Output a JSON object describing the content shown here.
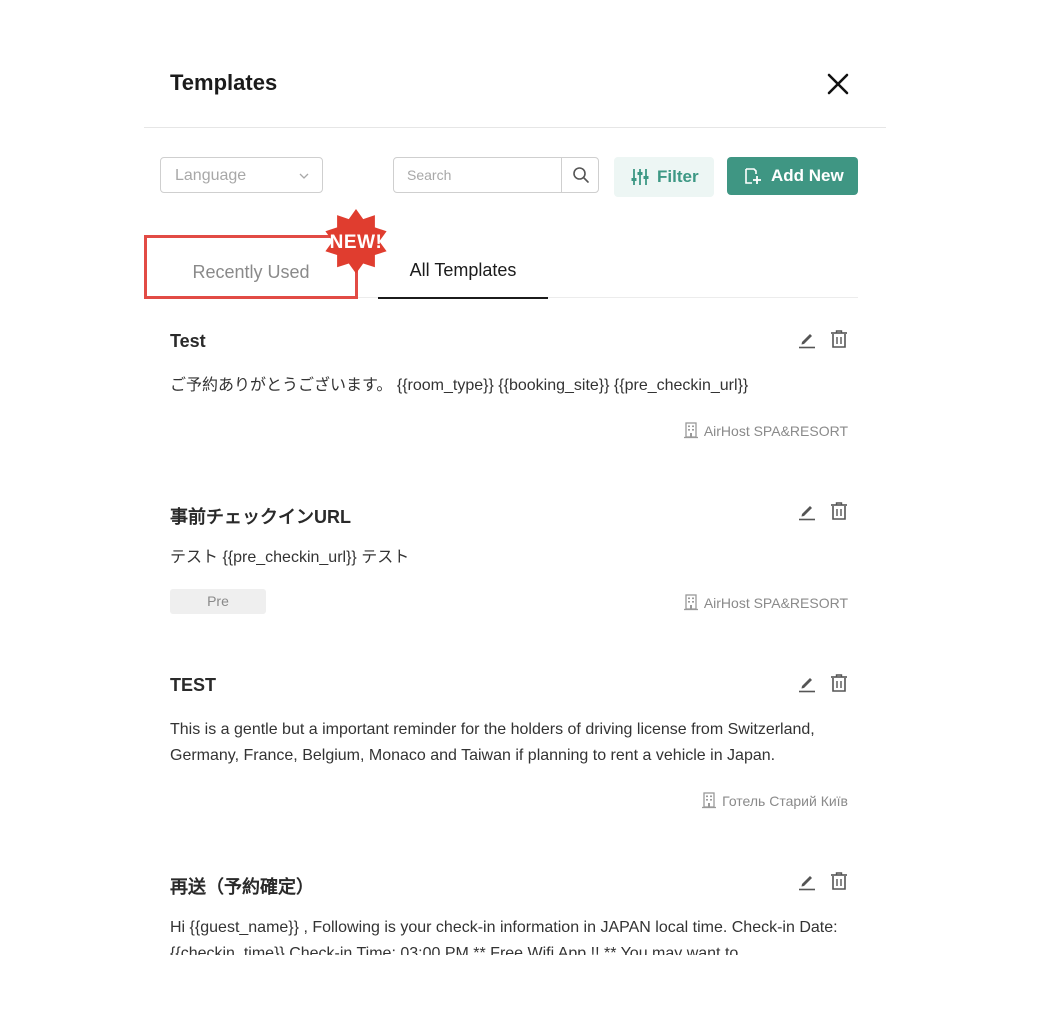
{
  "dialog": {
    "title": "Templates"
  },
  "toolbar": {
    "language_placeholder": "Language",
    "search_placeholder": "Search",
    "filter_label": "Filter",
    "add_new_label": "Add New"
  },
  "tabs": {
    "recently_used": "Recently Used",
    "all_templates": "All Templates",
    "new_badge": "NEW!",
    "active": "All Templates"
  },
  "templates": [
    {
      "name": "Test",
      "body": "ご予約ありがとうございます。 {{room_type}} {{booking_site}} {{pre_checkin_url}}",
      "property": "AirHost SPA&RESORT"
    },
    {
      "name": "事前チェックインURL",
      "body": "テスト {{pre_checkin_url}} テスト",
      "tag": "Pre",
      "property": "AirHost SPA&RESORT"
    },
    {
      "name": "TEST",
      "body": "This is a gentle but a important reminder for the holders of driving license from Switzerland, Germany, France, Belgium, Monaco and Taiwan if planning to rent a vehicle in Japan.",
      "property": "Готель Старий Київ"
    },
    {
      "name": "再送（予約確定）",
      "body": "Hi {{guest_name}} , Following is your check-in information in JAPAN local time. Check-in Date: {{checkin_time}} Check-in Time: 03:00 PM ** Free Wifi App !! ** You may want to"
    }
  ],
  "colors": {
    "accent": "#3f9683",
    "accent_light": "#edf6f4",
    "highlight": "#e24b45"
  }
}
